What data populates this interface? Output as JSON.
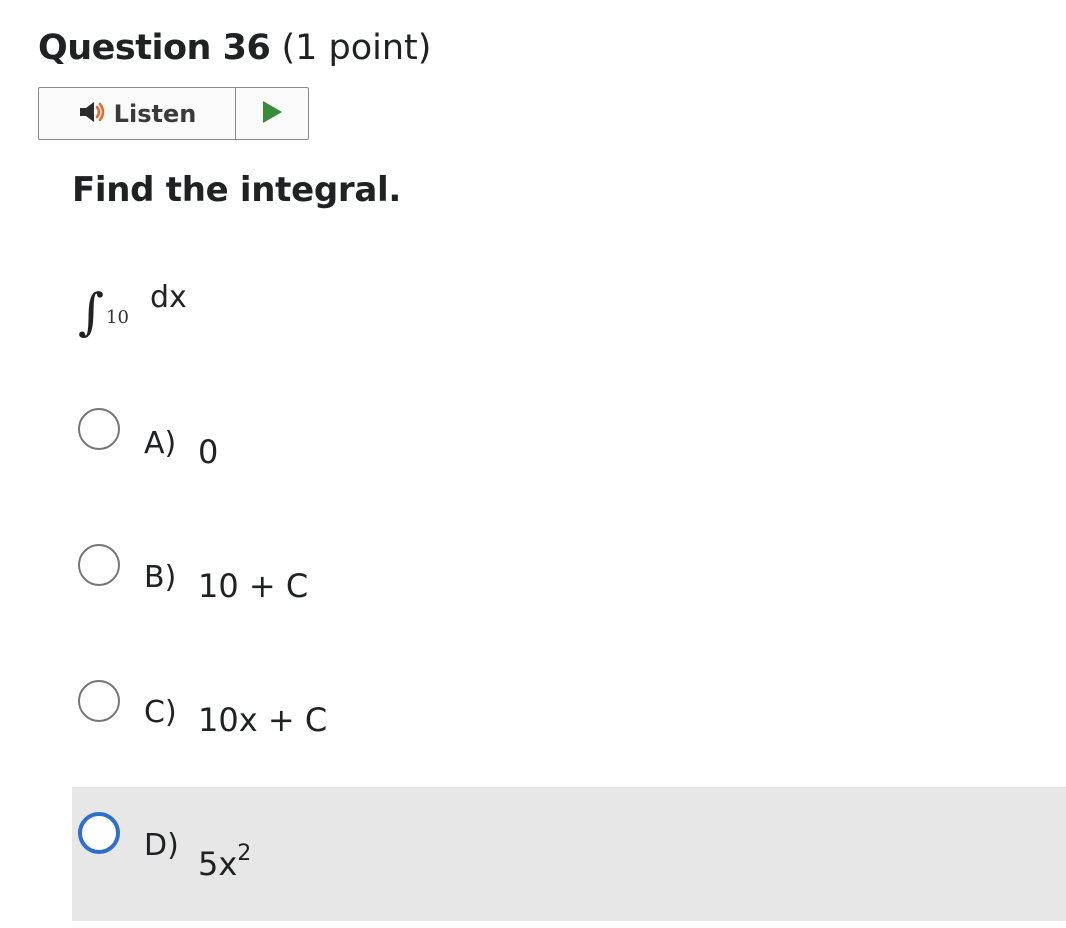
{
  "question": {
    "number_label": "Question 36",
    "points_label": "(1 point)"
  },
  "listen": {
    "label": "Listen",
    "speaker_icon": "speaker-icon",
    "play_icon": "play-icon",
    "play_color": "#3d8a3d",
    "speaker_color": "#2b2b2b",
    "wave_color": "#e5692a"
  },
  "prompt": "Find the integral.",
  "integral": {
    "sign": "∫",
    "coefficient": "10",
    "differential": "dx"
  },
  "options": [
    {
      "letter": "A)",
      "value": "0",
      "selected": false
    },
    {
      "letter": "B)",
      "value": "10 + C",
      "selected": false
    },
    {
      "letter": "C)",
      "value": "10x + C",
      "selected": false
    },
    {
      "letter": "D)",
      "value_base": "5x",
      "value_exp": "2",
      "selected": true
    }
  ],
  "colors": {
    "selected_radio": "#2f6fcb",
    "selected_row_bg": "#e7e7e7"
  }
}
